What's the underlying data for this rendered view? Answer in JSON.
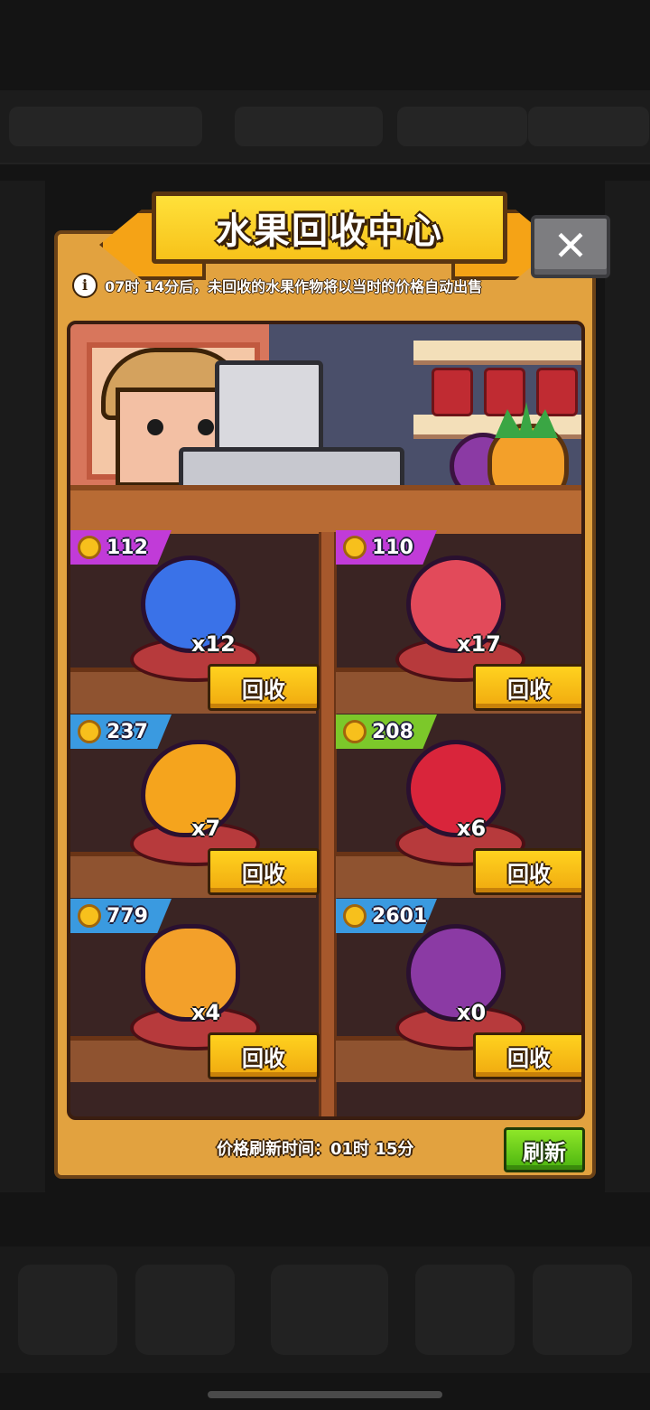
{
  "dialog": {
    "title": "水果回收中心",
    "close_glyph": "✕",
    "notice": "07时 14分后，未回收的水果作物将以当时的价格自动出售",
    "info_glyph": "i"
  },
  "items": [
    {
      "fruit": "blueberry",
      "price": "112",
      "qty": "x12",
      "button": "回收",
      "tag_color": "#c13bd8",
      "fruit_color": "#3a72e8"
    },
    {
      "fruit": "lychee",
      "price": "110",
      "qty": "x17",
      "button": "回收",
      "tag_color": "#c13bd8",
      "fruit_color": "#e24a5a"
    },
    {
      "fruit": "mango",
      "price": "237",
      "qty": "x7",
      "button": "回收",
      "tag_color": "#3a9ae0",
      "fruit_color": "#f5a41d"
    },
    {
      "fruit": "pomegranate",
      "price": "208",
      "qty": "x6",
      "button": "回收",
      "tag_color": "#7cc82a",
      "fruit_color": "#d9253b"
    },
    {
      "fruit": "pineapple",
      "price": "779",
      "qty": "x4",
      "button": "回收",
      "tag_color": "#3a9ae0",
      "fruit_color": "#f3a02a"
    },
    {
      "fruit": "mangosteen",
      "price": "2601",
      "qty": "x0",
      "button": "回收",
      "tag_color": "#3a9ae0",
      "fruit_color": "#8b3aa4"
    }
  ],
  "footer": {
    "refresh_time": "价格刷新时间：01时 15分",
    "refresh_button": "刷新"
  }
}
